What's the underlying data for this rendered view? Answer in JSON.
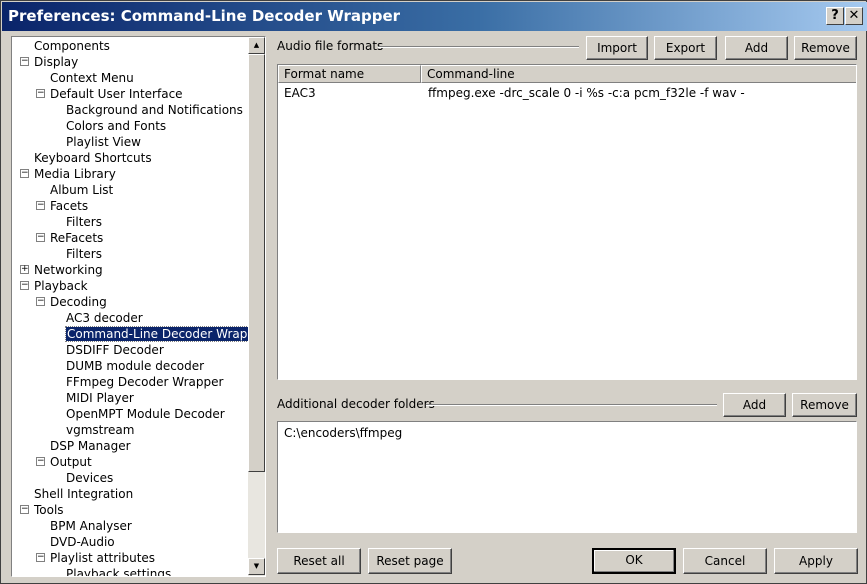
{
  "window": {
    "title": "Preferences: Command-Line Decoder Wrapper",
    "help_label": "?",
    "close_label": "✕"
  },
  "tree": {
    "items": [
      {
        "label": "Components",
        "level": 0,
        "expander": ""
      },
      {
        "label": "Display",
        "level": 0,
        "expander": "−"
      },
      {
        "label": "Context Menu",
        "level": 1,
        "expander": ""
      },
      {
        "label": "Default User Interface",
        "level": 1,
        "expander": "−"
      },
      {
        "label": "Background and Notifications",
        "level": 2,
        "expander": ""
      },
      {
        "label": "Colors and Fonts",
        "level": 2,
        "expander": ""
      },
      {
        "label": "Playlist View",
        "level": 2,
        "expander": ""
      },
      {
        "label": "Keyboard Shortcuts",
        "level": 0,
        "expander": ""
      },
      {
        "label": "Media Library",
        "level": 0,
        "expander": "−"
      },
      {
        "label": "Album List",
        "level": 1,
        "expander": ""
      },
      {
        "label": "Facets",
        "level": 1,
        "expander": "−"
      },
      {
        "label": "Filters",
        "level": 2,
        "expander": ""
      },
      {
        "label": "ReFacets",
        "level": 1,
        "expander": "−"
      },
      {
        "label": "Filters",
        "level": 2,
        "expander": ""
      },
      {
        "label": "Networking",
        "level": 0,
        "expander": "+"
      },
      {
        "label": "Playback",
        "level": 0,
        "expander": "−"
      },
      {
        "label": "Decoding",
        "level": 1,
        "expander": "−"
      },
      {
        "label": "AC3 decoder",
        "level": 2,
        "expander": ""
      },
      {
        "label": "Command-Line Decoder Wrapper",
        "level": 2,
        "expander": "",
        "selected": true
      },
      {
        "label": "DSDIFF Decoder",
        "level": 2,
        "expander": ""
      },
      {
        "label": "DUMB module decoder",
        "level": 2,
        "expander": ""
      },
      {
        "label": "FFmpeg Decoder Wrapper",
        "level": 2,
        "expander": ""
      },
      {
        "label": "MIDI Player",
        "level": 2,
        "expander": ""
      },
      {
        "label": "OpenMPT Module Decoder",
        "level": 2,
        "expander": ""
      },
      {
        "label": "vgmstream",
        "level": 2,
        "expander": ""
      },
      {
        "label": "DSP Manager",
        "level": 1,
        "expander": ""
      },
      {
        "label": "Output",
        "level": 1,
        "expander": "−"
      },
      {
        "label": "Devices",
        "level": 2,
        "expander": ""
      },
      {
        "label": "Shell Integration",
        "level": 0,
        "expander": ""
      },
      {
        "label": "Tools",
        "level": 0,
        "expander": "−"
      },
      {
        "label": "BPM Analyser",
        "level": 1,
        "expander": ""
      },
      {
        "label": "DVD-Audio",
        "level": 1,
        "expander": ""
      },
      {
        "label": "Playlist attributes",
        "level": 1,
        "expander": "−"
      },
      {
        "label": "Playback settings",
        "level": 2,
        "expander": ""
      }
    ],
    "scroll_up": "▲",
    "scroll_down": "▼"
  },
  "formats": {
    "heading": "Audio file formats",
    "import_label": "Import",
    "export_label": "Export",
    "add_label": "Add",
    "remove_label": "Remove",
    "columns": [
      "Format name",
      "Command-line"
    ],
    "rows": [
      [
        "EAC3",
        "ffmpeg.exe -drc_scale 0 -i %s -c:a pcm_f32le -f wav -"
      ]
    ]
  },
  "folders": {
    "heading": "Additional decoder folders",
    "add_label": "Add",
    "remove_label": "Remove",
    "entries": [
      "C:\\encoders\\ffmpeg"
    ]
  },
  "footer": {
    "reset_all_label": "Reset all",
    "reset_page_label": "Reset page",
    "ok_label": "OK",
    "cancel_label": "Cancel",
    "apply_label": "Apply"
  }
}
